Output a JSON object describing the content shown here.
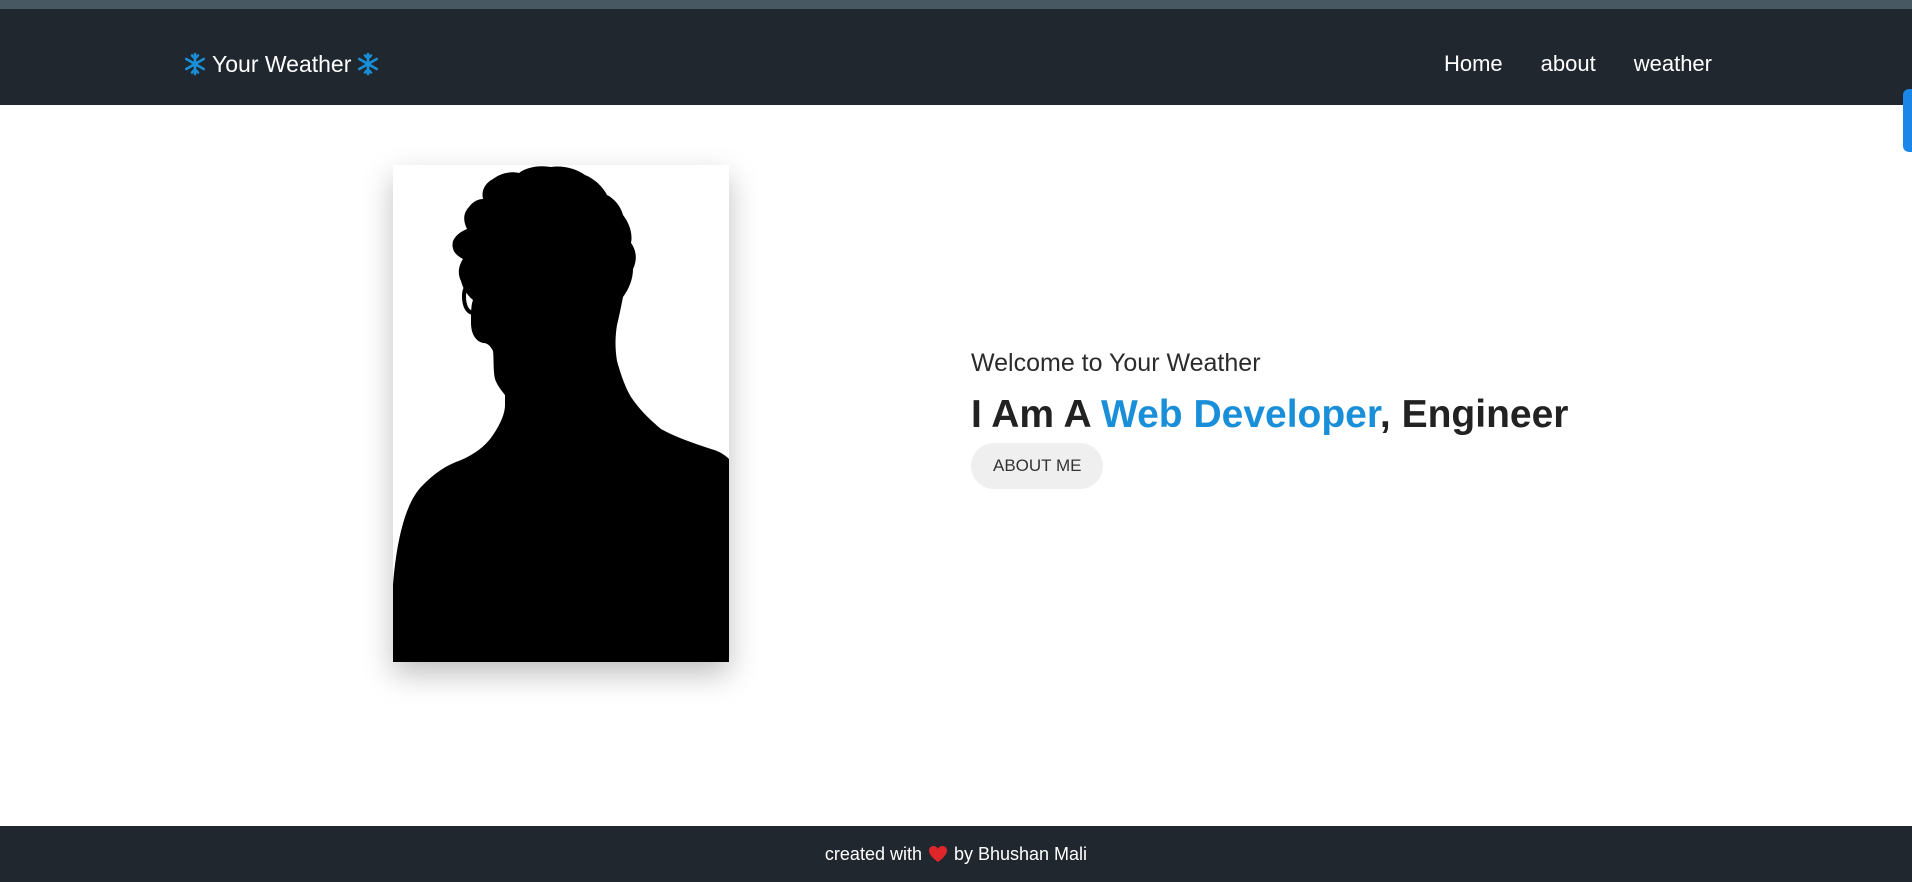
{
  "navbar": {
    "brand": "Your Weather",
    "brand_icon": "snowflake-icon",
    "links": [
      "Home",
      "about",
      "weather"
    ]
  },
  "hero": {
    "welcome": "Welcome to Your Weather",
    "headline_prefix": "I Am A ",
    "headline_accent": "Web Developer",
    "headline_suffix": ", Engineer",
    "button": "ABOUT ME",
    "portrait_icon": "silhouette-portrait"
  },
  "footer": {
    "text_before": "created with",
    "icon": "heart-icon",
    "text_after": "by Bhushan Mali"
  },
  "colors": {
    "navbar_bg": "#20272f",
    "accent": "#1a8fd9",
    "button_bg": "#efefef",
    "heart": "#e0262b"
  }
}
